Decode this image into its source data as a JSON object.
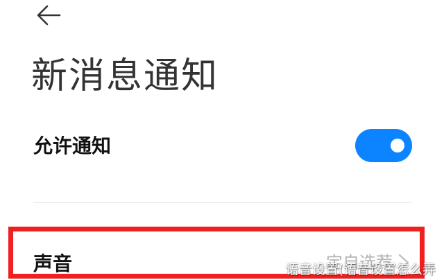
{
  "header": {
    "back_icon": "arrow-left-icon",
    "title": "新消息通知"
  },
  "settings": {
    "allow_notifications": {
      "label": "允许通知",
      "enabled": true
    },
    "sound": {
      "label": "声音",
      "value": "定自选荐",
      "chevron_icon": "chevron-right-icon"
    }
  },
  "annotation": {
    "highlight_color": "#ef2020"
  },
  "watermark": {
    "text": "语音设置(语音设置怎么弄"
  },
  "colors": {
    "toggle_on": "#0d84ff",
    "title": "#333333",
    "label": "#111111",
    "value": "#b3b3b3"
  }
}
